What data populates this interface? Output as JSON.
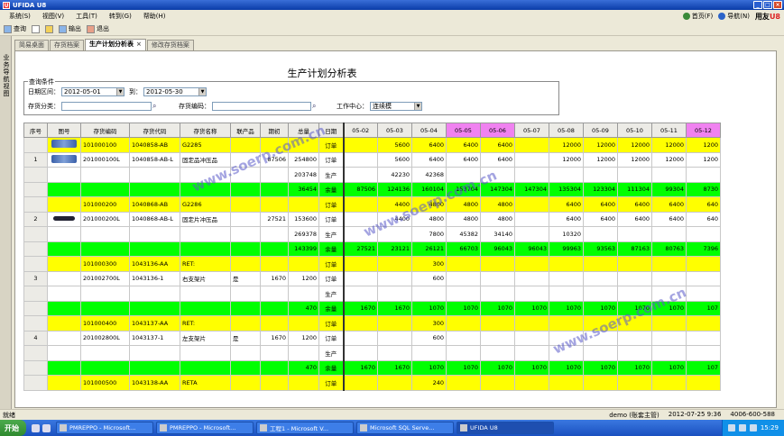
{
  "window": {
    "title": "UFIDA U8",
    "controls": [
      "_",
      "□",
      "×"
    ]
  },
  "menu": {
    "items": [
      "系统(S)",
      "视图(V)",
      "工具(T)",
      "转到(G)",
      "帮助(H)"
    ],
    "home": "首页(F)",
    "nav": "导航(N)",
    "brand": "用友",
    "brand_suffix": "U8"
  },
  "toolbar": {
    "query": "查询",
    "output": "输出",
    "exit": "退出"
  },
  "side_label": "业务导航视图",
  "tabs": [
    {
      "label": "简易桌面",
      "active": false
    },
    {
      "label": "存货档案",
      "active": false
    },
    {
      "label": "生产计划分析表",
      "active": true
    },
    {
      "label": "修改存货档案",
      "active": false
    }
  ],
  "report": {
    "title": "生产计划分析表",
    "query": {
      "legend": "查询条件",
      "date_label": "日期区间：",
      "date_from": "2012-05-01",
      "to_label": "到：",
      "date_to": "2012-05-30",
      "category_label": "存货分类：",
      "category": "",
      "code_label": "存货编码：",
      "code": "",
      "center_label": "工作中心：",
      "center": "连续模"
    }
  },
  "grid": {
    "headers": [
      "序号",
      "图号",
      "存货编码",
      "存货代码",
      "存货名称",
      "联产品",
      "期初",
      "总量",
      "日期"
    ],
    "dates": [
      "05-02",
      "05-03",
      "05-04",
      "05-05",
      "05-06",
      "05-07",
      "05-08",
      "05-09",
      "05-10",
      "05-11",
      "05-12"
    ],
    "pink_dates": [
      "05-05",
      "05-06",
      "05-12"
    ],
    "rows": [
      {
        "kind": "y",
        "idx": "",
        "pic": "big",
        "code": "101000100",
        "dcode": "1040858-AB",
        "name": "G2285",
        "co": "",
        "open": "",
        "total": "",
        "type": "订单",
        "vals": [
          "",
          "5600",
          "6400",
          "6400",
          "6400",
          "",
          "12000",
          "12000",
          "12000",
          "12000",
          "1200"
        ]
      },
      {
        "kind": "w",
        "idx": "1",
        "pic": "big2",
        "code": "201000100L",
        "dcode": "1040858-AB-L",
        "name": "固定品冲压品",
        "co": "",
        "open": "87506",
        "total": "254800",
        "type": "订单",
        "vals": [
          "",
          "5600",
          "6400",
          "6400",
          "6400",
          "",
          "12000",
          "12000",
          "12000",
          "12000",
          "1200"
        ]
      },
      {
        "kind": "w",
        "idx": "",
        "pic": "",
        "code": "",
        "dcode": "",
        "name": "",
        "co": "",
        "open": "",
        "total": "203748",
        "type": "生产",
        "vals": [
          "",
          "42230",
          "42368",
          "",
          "",
          "",
          "",
          "",
          "",
          "",
          ""
        ]
      },
      {
        "kind": "g",
        "idx": "",
        "pic": "",
        "code": "",
        "dcode": "",
        "name": "",
        "co": "",
        "open": "",
        "total": "36454",
        "type": "余量",
        "vals": [
          "87506",
          "124136",
          "160104",
          "153704",
          "147304",
          "147304",
          "135304",
          "123304",
          "111304",
          "99304",
          "8730"
        ]
      },
      {
        "kind": "y",
        "idx": "",
        "pic": "",
        "code": "101000200",
        "dcode": "1040868-AB",
        "name": "G2286",
        "co": "",
        "open": "",
        "total": "",
        "type": "订单",
        "vals": [
          "",
          "4400",
          "4800",
          "4800",
          "4800",
          "",
          "6400",
          "6400",
          "6400",
          "6400",
          "640"
        ]
      },
      {
        "kind": "w",
        "idx": "2",
        "pic": "small",
        "code": "201000200L",
        "dcode": "1040868-AB-L",
        "name": "固定片冲压品",
        "co": "",
        "open": "27521",
        "total": "153600",
        "type": "订单",
        "vals": [
          "",
          "4400",
          "4800",
          "4800",
          "4800",
          "",
          "6400",
          "6400",
          "6400",
          "6400",
          "640"
        ]
      },
      {
        "kind": "w",
        "idx": "",
        "pic": "",
        "code": "",
        "dcode": "",
        "name": "",
        "co": "",
        "open": "",
        "total": "269378",
        "type": "生产",
        "vals": [
          "",
          "",
          "7800",
          "45382",
          "34140",
          "",
          "10320",
          "",
          "",
          "",
          ""
        ]
      },
      {
        "kind": "g",
        "idx": "",
        "pic": "",
        "code": "",
        "dcode": "",
        "name": "",
        "co": "",
        "open": "",
        "total": "143399",
        "type": "余量",
        "vals": [
          "27521",
          "23121",
          "26121",
          "66703",
          "96043",
          "96043",
          "99963",
          "93563",
          "87163",
          "80763",
          "7396"
        ]
      },
      {
        "kind": "y",
        "idx": "",
        "pic": "",
        "code": "101000300",
        "dcode": "1043136-AA",
        "name": "RET:",
        "co": "",
        "open": "",
        "total": "",
        "type": "订单",
        "vals": [
          "",
          "",
          "300",
          "",
          "",
          "",
          "",
          "",
          "",
          "",
          ""
        ]
      },
      {
        "kind": "w",
        "idx": "3",
        "pic": "",
        "code": "201002700L",
        "dcode": "1043136-1",
        "name": "右支架片",
        "co": "是",
        "open": "1670",
        "total": "1200",
        "type": "订单",
        "vals": [
          "",
          "",
          "600",
          "",
          "",
          "",
          "",
          "",
          "",
          "",
          ""
        ]
      },
      {
        "kind": "w",
        "idx": "",
        "pic": "",
        "code": "",
        "dcode": "",
        "name": "",
        "co": "",
        "open": "",
        "total": "",
        "type": "生产",
        "vals": [
          "",
          "",
          "",
          "",
          "",
          "",
          "",
          "",
          "",
          "",
          ""
        ]
      },
      {
        "kind": "g",
        "idx": "",
        "pic": "",
        "code": "",
        "dcode": "",
        "name": "",
        "co": "",
        "open": "",
        "total": "470",
        "type": "余量",
        "vals": [
          "1670",
          "1670",
          "1070",
          "1070",
          "1070",
          "1070",
          "1070",
          "1070",
          "1070",
          "1070",
          "107"
        ]
      },
      {
        "kind": "y",
        "idx": "",
        "pic": "",
        "code": "101000400",
        "dcode": "1043137-AA",
        "name": "RET:",
        "co": "",
        "open": "",
        "total": "",
        "type": "订单",
        "vals": [
          "",
          "",
          "300",
          "",
          "",
          "",
          "",
          "",
          "",
          "",
          ""
        ]
      },
      {
        "kind": "w",
        "idx": "4",
        "pic": "",
        "code": "201002800L",
        "dcode": "1043137-1",
        "name": "左支架片",
        "co": "是",
        "open": "1670",
        "total": "1200",
        "type": "订单",
        "vals": [
          "",
          "",
          "600",
          "",
          "",
          "",
          "",
          "",
          "",
          "",
          ""
        ]
      },
      {
        "kind": "w",
        "idx": "",
        "pic": "",
        "code": "",
        "dcode": "",
        "name": "",
        "co": "",
        "open": "",
        "total": "",
        "type": "生产",
        "vals": [
          "",
          "",
          "",
          "",
          "",
          "",
          "",
          "",
          "",
          "",
          ""
        ]
      },
      {
        "kind": "g",
        "idx": "",
        "pic": "",
        "code": "",
        "dcode": "",
        "name": "",
        "co": "",
        "open": "",
        "total": "470",
        "type": "余量",
        "vals": [
          "1670",
          "1670",
          "1070",
          "1070",
          "1070",
          "1070",
          "1070",
          "1070",
          "1070",
          "1070",
          "107"
        ]
      },
      {
        "kind": "y",
        "idx": "",
        "pic": "",
        "code": "101000500",
        "dcode": "1043138-AA",
        "name": "RETA",
        "co": "",
        "open": "",
        "total": "",
        "type": "订单",
        "vals": [
          "",
          "",
          "240",
          "",
          "",
          "",
          "",
          "",
          "",
          "",
          ""
        ]
      }
    ]
  },
  "watermark": "www.soerp.com.cn",
  "status": {
    "ready": "就绪",
    "user": "demo (账套主管)",
    "date": "2012-07-25",
    "time": "9:36",
    "phone": "4006-600-588"
  },
  "taskbar": {
    "start": "开始",
    "buttons": [
      {
        "label": "PMREPPO - Microsoft...",
        "active": false
      },
      {
        "label": "PMREPPO - Microsoft...",
        "active": false
      },
      {
        "label": "工程1 - Microsoft V...",
        "active": false
      },
      {
        "label": "Microsoft SQL Serve...",
        "active": false
      },
      {
        "label": "UFIDA U8",
        "active": true
      }
    ],
    "clock": "15:29"
  }
}
